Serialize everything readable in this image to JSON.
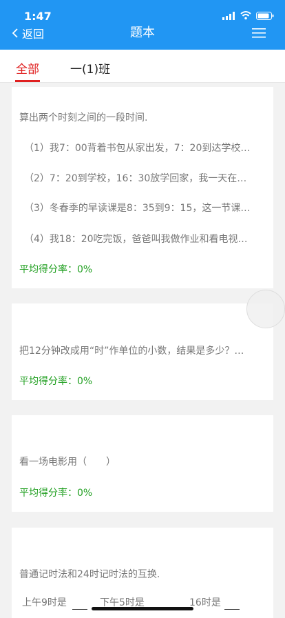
{
  "status": {
    "time": "1:47"
  },
  "nav": {
    "back_label": "返回",
    "title": "题本"
  },
  "tabs": [
    {
      "label": "全部"
    },
    {
      "label": "一(1)班"
    }
  ],
  "questions": [
    {
      "text": "算出两个时刻之间的一段时间.",
      "subs": [
        "（1）我7：00背着书包从家出发，7：20到达学校…",
        "（2）7：20到学校，16：30放学回家，我一天在…",
        "（3）冬春季的早读课是8：35到9：15，这一节课…",
        "（4）我18：20吃完饭，爸爸叫我做作业和看电视…"
      ],
      "rate": "平均得分率：0%"
    },
    {
      "text": "把12分钟改成用“时”作单位的小数，结果是多少？…",
      "rate": "平均得分率：0%"
    },
    {
      "text": "看一场电影用（　　）",
      "rate": "平均得分率：0%"
    },
    {
      "text": "普通记时法和24时记时法的互换.",
      "blanks": [
        "上午9时是",
        "下午5时是",
        "16时是"
      ]
    }
  ]
}
